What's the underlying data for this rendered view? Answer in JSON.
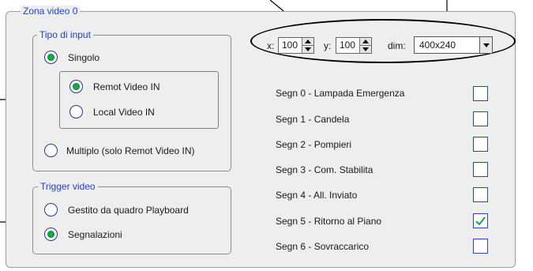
{
  "zone_title": "Zona video 0",
  "input_type": {
    "title": "Tipo di input",
    "single_label": "Singolo",
    "single_checked": true,
    "remote_label": "Remot Video IN",
    "remote_checked": true,
    "local_label": "Local Video IN",
    "local_checked": false,
    "multiple_label": "Multiplo (solo Remot Video IN)",
    "multiple_checked": false
  },
  "trigger": {
    "title": "Trigger video",
    "playboard_label": "Gestito da quadro Playboard",
    "playboard_checked": false,
    "signals_label": "Segnalazioni",
    "signals_checked": true
  },
  "position": {
    "x_label": "x:",
    "x_value": "100",
    "y_label": "y:",
    "y_value": "100",
    "dim_label": "dim:",
    "dim_value": "400x240"
  },
  "signals": [
    {
      "label": "Segn 0 - Lampada Emergenza",
      "checked": false
    },
    {
      "label": "Segn 1 - Candela",
      "checked": false
    },
    {
      "label": "Segn 2 - Pompieri",
      "checked": false
    },
    {
      "label": "Segn 3 - Com. Stabilita",
      "checked": false
    },
    {
      "label": "Segn 4 - All. Inviato",
      "checked": false
    },
    {
      "label": "Segn 5 - Ritorno al Piano",
      "checked": true
    },
    {
      "label": "Segn 6 - Sovraccarico",
      "checked": false
    }
  ],
  "colors": {
    "legend": "#1f3fd6",
    "radio_dot": "#13a94a",
    "check_mark": "#13a94a"
  }
}
